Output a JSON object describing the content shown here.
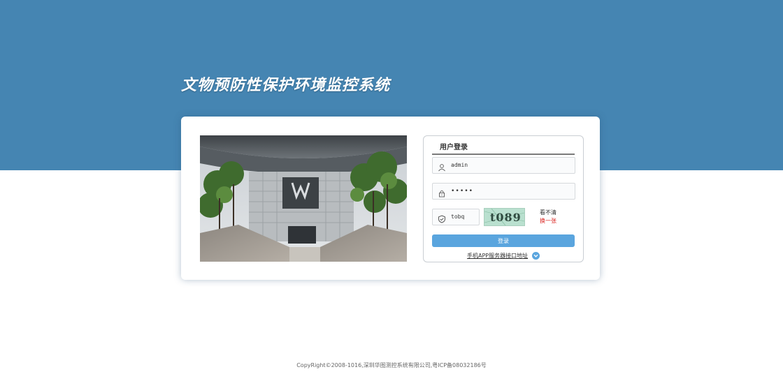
{
  "header": {
    "system_title": "文物预防性保护环境监控系统"
  },
  "colors": {
    "top_band": "#4585b2",
    "login_button": "#5aa5de",
    "refresh_link": "#d9211d"
  },
  "login_form": {
    "tab_label": "用户登录",
    "username": {
      "value": "admin",
      "icon": "user-icon"
    },
    "password": {
      "value": "•••••",
      "icon": "lock-icon"
    },
    "captcha": {
      "value": "tobq",
      "icon": "shield-icon",
      "image_text": "t089",
      "unclear_label": "看不清",
      "refresh_label": "换一张"
    },
    "login_button": "登录",
    "app_link": "手机APP服务器接口地址",
    "app_link_icon": "chevron-down-icon"
  },
  "footer": {
    "copyright": "CopyRight©2008-1016,深圳华图测控系统有限公司,粤ICP备08032186号"
  }
}
